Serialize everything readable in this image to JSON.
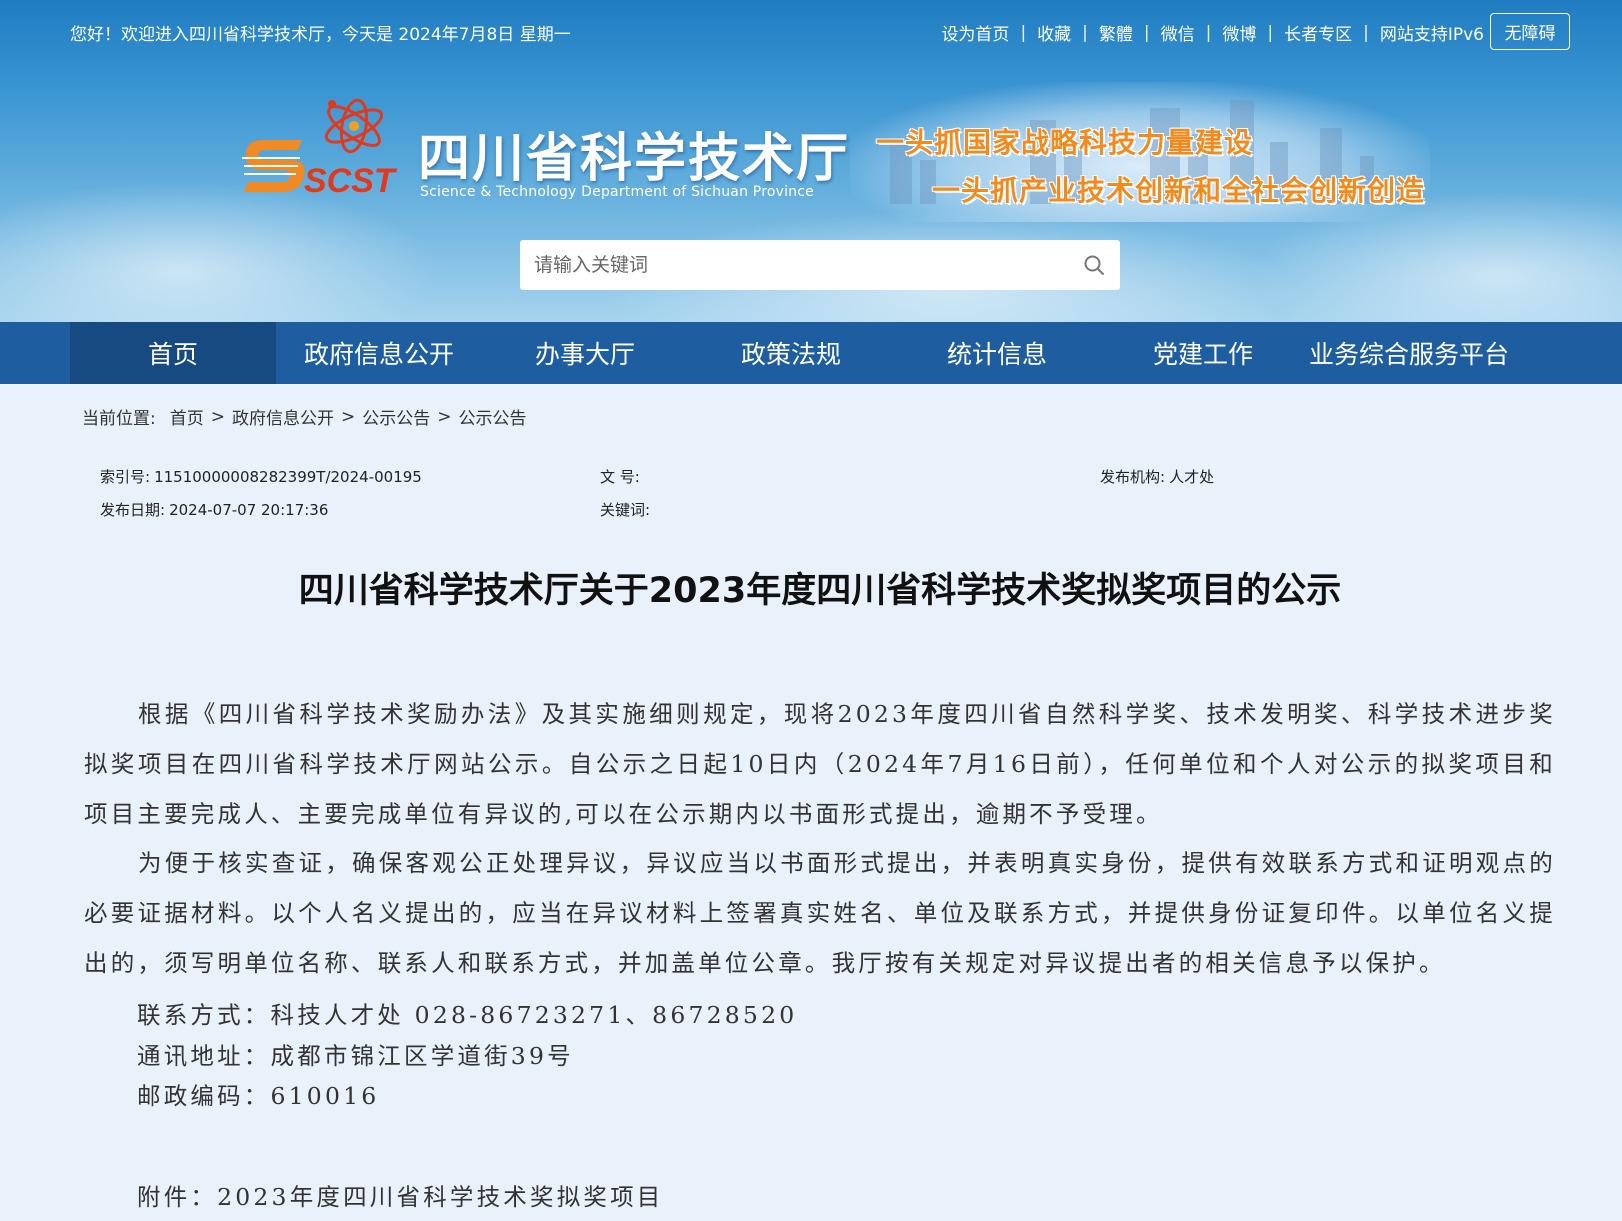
{
  "topbar": {
    "greeting": "您好！欢迎进入四川省科学技术厅，今天是 2024年7月8日 星期一",
    "links": [
      "设为首页",
      "收藏",
      "繁體",
      "微信",
      "微博",
      "长者专区",
      "网站支持IPv6"
    ],
    "accessibility_button": "无障碍"
  },
  "branding": {
    "logo_text": "SCST",
    "site_name": "四川省科学技术厅",
    "site_name_en": "Science & Technology Department of Sichuan Province",
    "slogan_line1": "一头抓国家战略科技力量建设",
    "slogan_line2": "一头抓产业技术创新和全社会创新创造"
  },
  "search": {
    "placeholder": "请输入关键词",
    "icon": "search-icon"
  },
  "nav": {
    "items": [
      {
        "label": "首页",
        "active": true
      },
      {
        "label": "政府信息公开",
        "active": false
      },
      {
        "label": "办事大厅",
        "active": false
      },
      {
        "label": "政策法规",
        "active": false
      },
      {
        "label": "统计信息",
        "active": false
      },
      {
        "label": "党建工作",
        "active": false
      },
      {
        "label": "业务综合服务平台",
        "active": false
      }
    ]
  },
  "breadcrumb": {
    "prefix": "当前位置:",
    "items": [
      "首页",
      "政府信息公开",
      "公示公告",
      "公示公告"
    ]
  },
  "meta": {
    "index_label": "索引号:",
    "index_value": "11510000008282399T/2024-00195",
    "doc_no_label": "文 号:",
    "doc_no_value": "",
    "publisher_label": "发布机构:",
    "publisher_value": "人才处",
    "date_label": "发布日期:",
    "date_value": "2024-07-07 20:17:36",
    "keywords_label": "关键词:",
    "keywords_value": ""
  },
  "article": {
    "title": "四川省科学技术厅关于2023年度四川省科学技术奖拟奖项目的公示",
    "paragraph1": "根据《四川省科学技术奖励办法》及其实施细则规定，现将2023年度四川省自然科学奖、技术发明奖、科学技术进步奖拟奖项目在四川省科学技术厅网站公示。自公示之日起10日内（2024年7月16日前），任何单位和个人对公示的拟奖项目和项目主要完成人、主要完成单位有异议的,可以在公示期内以书面形式提出，逾期不予受理。",
    "paragraph2": "为便于核实查证，确保客观公正处理异议，异议应当以书面形式提出，并表明真实身份，提供有效联系方式和证明观点的必要证据材料。以个人名义提出的，应当在异议材料上签署真实姓名、单位及联系方式，并提供身份证复印件。以单位名义提出的，须写明单位名称、联系人和联系方式，并加盖单位公章。我厅按有关规定对异议提出者的相关信息予以保护。",
    "contact": "联系方式：科技人才处  028-86723271、86728520",
    "address": "通讯地址：成都市锦江区学道街39号",
    "postcode": "邮政编码：610016",
    "attachment": "附件：2023年度四川省科学技术奖拟奖项目"
  },
  "colors": {
    "nav_bg": "#1e5ea0",
    "nav_active": "#164a80",
    "page_bg": "#e9f2fb",
    "slogan": "#f28a1d"
  }
}
